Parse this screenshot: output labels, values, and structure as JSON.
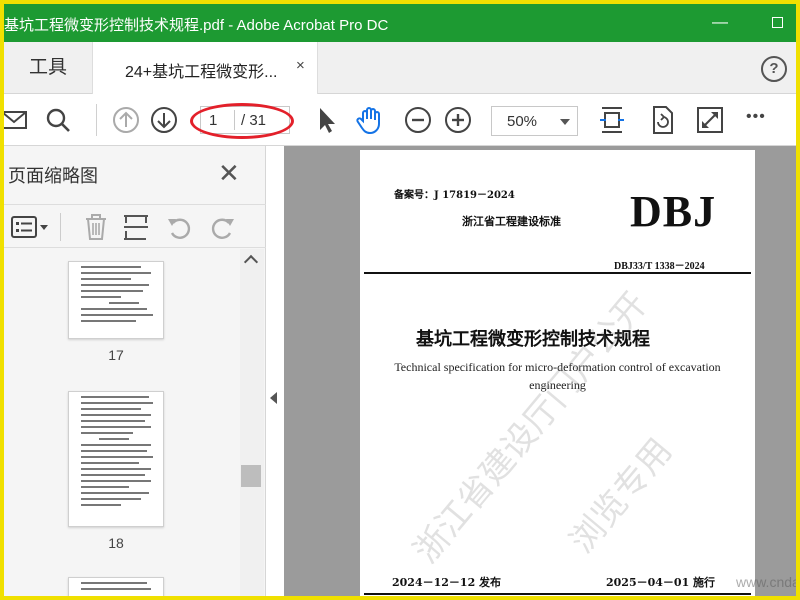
{
  "window": {
    "title": "基坑工程微变形控制技术规程.pdf - Adobe Acrobat Pro DC",
    "minimize_glyph": "—"
  },
  "tabs": {
    "tools_label": "工具",
    "document_tab_label": "24+基坑工程微变形...",
    "close_glyph": "×",
    "help_glyph": "?"
  },
  "toolbar": {
    "page_current": "1",
    "page_total": "/ 31",
    "zoom_value": "50%",
    "more_glyph": "•••",
    "icons": [
      "mail-icon",
      "search-icon",
      "page-up-icon",
      "page-down-icon",
      "select-cursor-icon",
      "hand-tool-icon",
      "zoom-out-icon",
      "zoom-in-icon",
      "fit-page-icon",
      "rotate-view-icon",
      "full-screen-icon",
      "more-icon"
    ],
    "highlight_color": "#e3202a"
  },
  "sidebar": {
    "title": "页面缩略图",
    "close_glyph": "✕",
    "thumbnails": [
      {
        "page_label": "17"
      },
      {
        "page_label": "18"
      }
    ]
  },
  "document": {
    "registration_no": "备案号：J 17819－2024",
    "standard_org": "浙江省工程建设标准",
    "series_mark": "DBJ",
    "standard_code": "DBJ33/T 1338－2024",
    "title_cn": "基坑工程微变形控制技术规程",
    "title_en": "Technical specification for micro-deformation control of excavation engineering",
    "issue_date": "2024－12－12 发布",
    "implement_date": "2025－04－01 施行",
    "watermark_main": "浙江省建设厅门户公开",
    "watermark_sub": "浏览专用",
    "watermark_site": "www.cndao."
  },
  "colors": {
    "titlebar": "#1d9a32",
    "frame_border": "#f0e000",
    "hand_tool": "#1473e6"
  }
}
